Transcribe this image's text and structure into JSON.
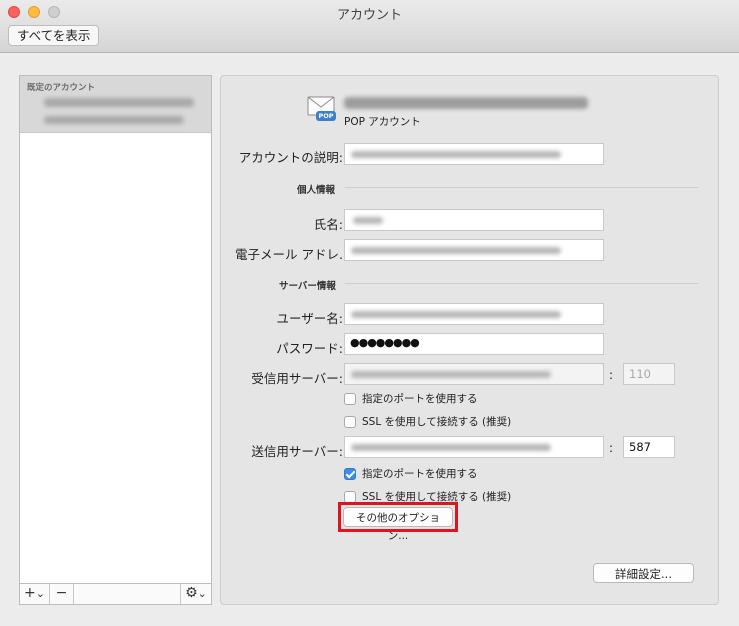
{
  "window": {
    "title": "アカウント"
  },
  "toolbar": {
    "show_all_label": "すべてを表示"
  },
  "sidebar": {
    "section_label": "既定のアカウント",
    "bottom": {
      "add": "+",
      "add_chevron": "⌄",
      "remove": "−",
      "gear": "⚙",
      "gear_chevron": "⌄"
    }
  },
  "account": {
    "type_label": "POP アカウント",
    "icon_badge": "POP"
  },
  "form": {
    "description_label": "アカウントの説明:",
    "personal_section": "個人情報",
    "name_label": "氏名:",
    "email_label": "電子メール アドレ.",
    "server_section": "サーバー情報",
    "username_label": "ユーザー名:",
    "password_label": "パスワード:",
    "password_value": "●●●●●●●●",
    "incoming_label": "受信用サーバー:",
    "incoming_port": "110",
    "incoming_use_port": "指定のポートを使用する",
    "incoming_use_port_checked": false,
    "incoming_ssl": "SSL を使用して接続する (推奨)",
    "incoming_ssl_checked": false,
    "outgoing_label": "送信用サーバー:",
    "outgoing_port": "587",
    "outgoing_use_port": "指定のポートを使用する",
    "outgoing_use_port_checked": true,
    "outgoing_ssl": "SSL を使用して接続する (推奨)",
    "outgoing_ssl_checked": false,
    "colon": ":",
    "more_options_button": "その他のオプション...",
    "advanced_button": "詳細設定..."
  },
  "colors": {
    "highlight": "#e0141e",
    "checkbox_accent": "#3a8ee6"
  }
}
